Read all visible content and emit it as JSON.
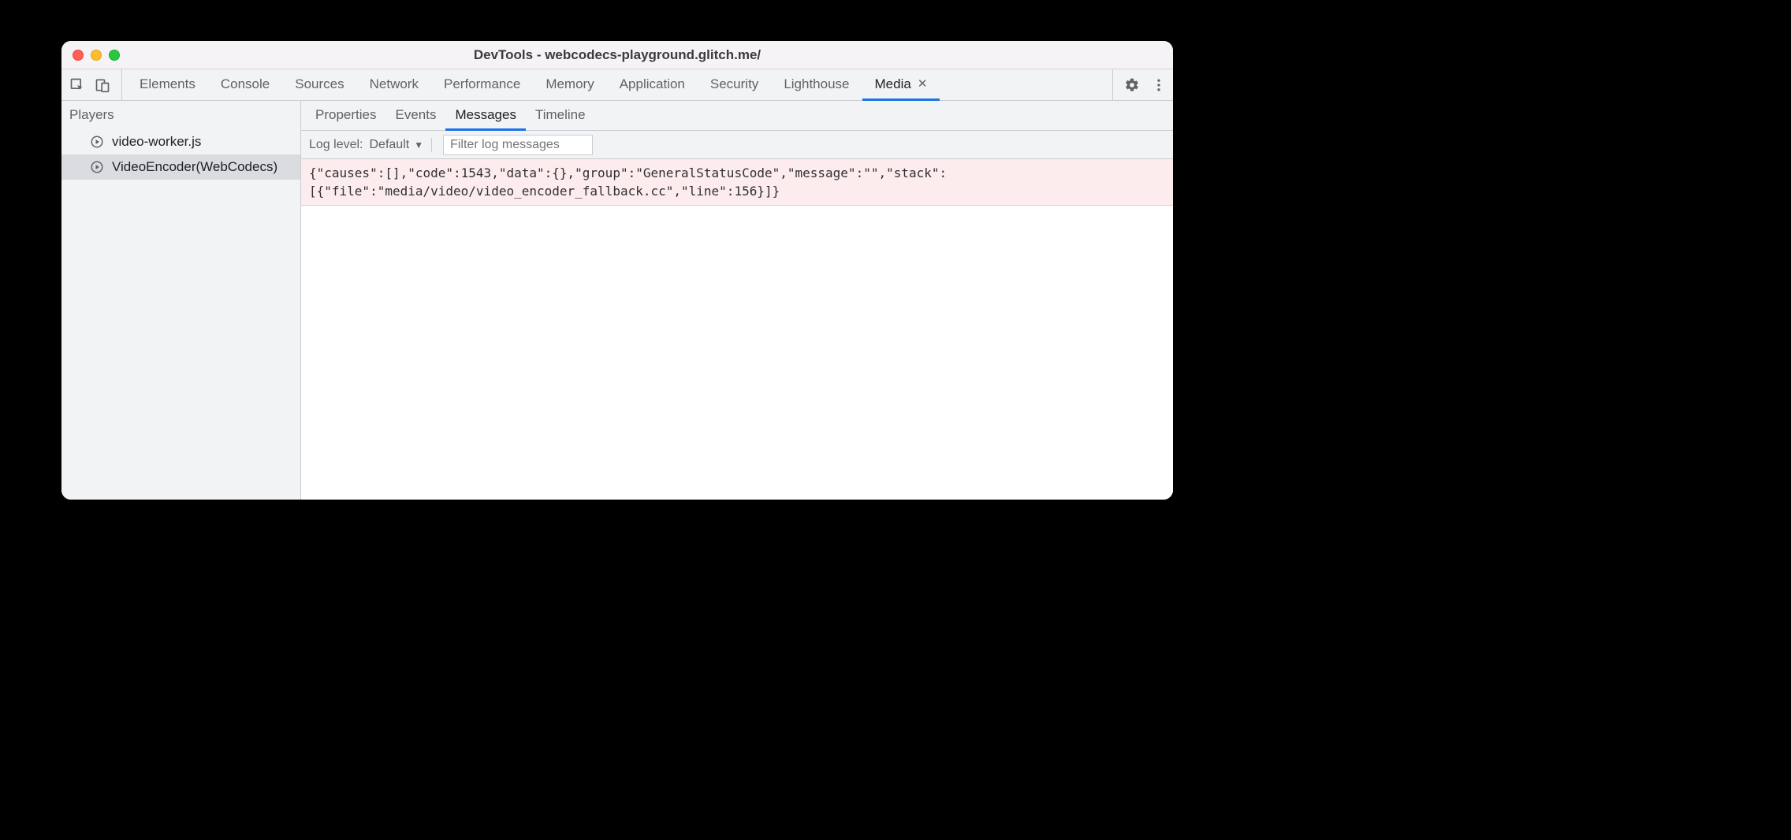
{
  "window": {
    "title": "DevTools - webcodecs-playground.glitch.me/"
  },
  "mainTabs": [
    {
      "label": "Elements",
      "active": false,
      "closable": false
    },
    {
      "label": "Console",
      "active": false,
      "closable": false
    },
    {
      "label": "Sources",
      "active": false,
      "closable": false
    },
    {
      "label": "Network",
      "active": false,
      "closable": false
    },
    {
      "label": "Performance",
      "active": false,
      "closable": false
    },
    {
      "label": "Memory",
      "active": false,
      "closable": false
    },
    {
      "label": "Application",
      "active": false,
      "closable": false
    },
    {
      "label": "Security",
      "active": false,
      "closable": false
    },
    {
      "label": "Lighthouse",
      "active": false,
      "closable": false
    },
    {
      "label": "Media",
      "active": true,
      "closable": true
    }
  ],
  "sidebar": {
    "header": "Players",
    "items": [
      {
        "label": "video-worker.js",
        "selected": false
      },
      {
        "label": "VideoEncoder(WebCodecs)",
        "selected": true
      }
    ]
  },
  "subTabs": [
    {
      "label": "Properties",
      "active": false
    },
    {
      "label": "Events",
      "active": false
    },
    {
      "label": "Messages",
      "active": true
    },
    {
      "label": "Timeline",
      "active": false
    }
  ],
  "filterbar": {
    "logLevelLabel": "Log level:",
    "logLevelValue": "Default",
    "filterPlaceholder": "Filter log messages"
  },
  "logEntries": [
    {
      "level": "error",
      "text": "{\"causes\":[],\"code\":1543,\"data\":{},\"group\":\"GeneralStatusCode\",\"message\":\"\",\"stack\":[{\"file\":\"media/video/video_encoder_fallback.cc\",\"line\":156}]}"
    }
  ]
}
